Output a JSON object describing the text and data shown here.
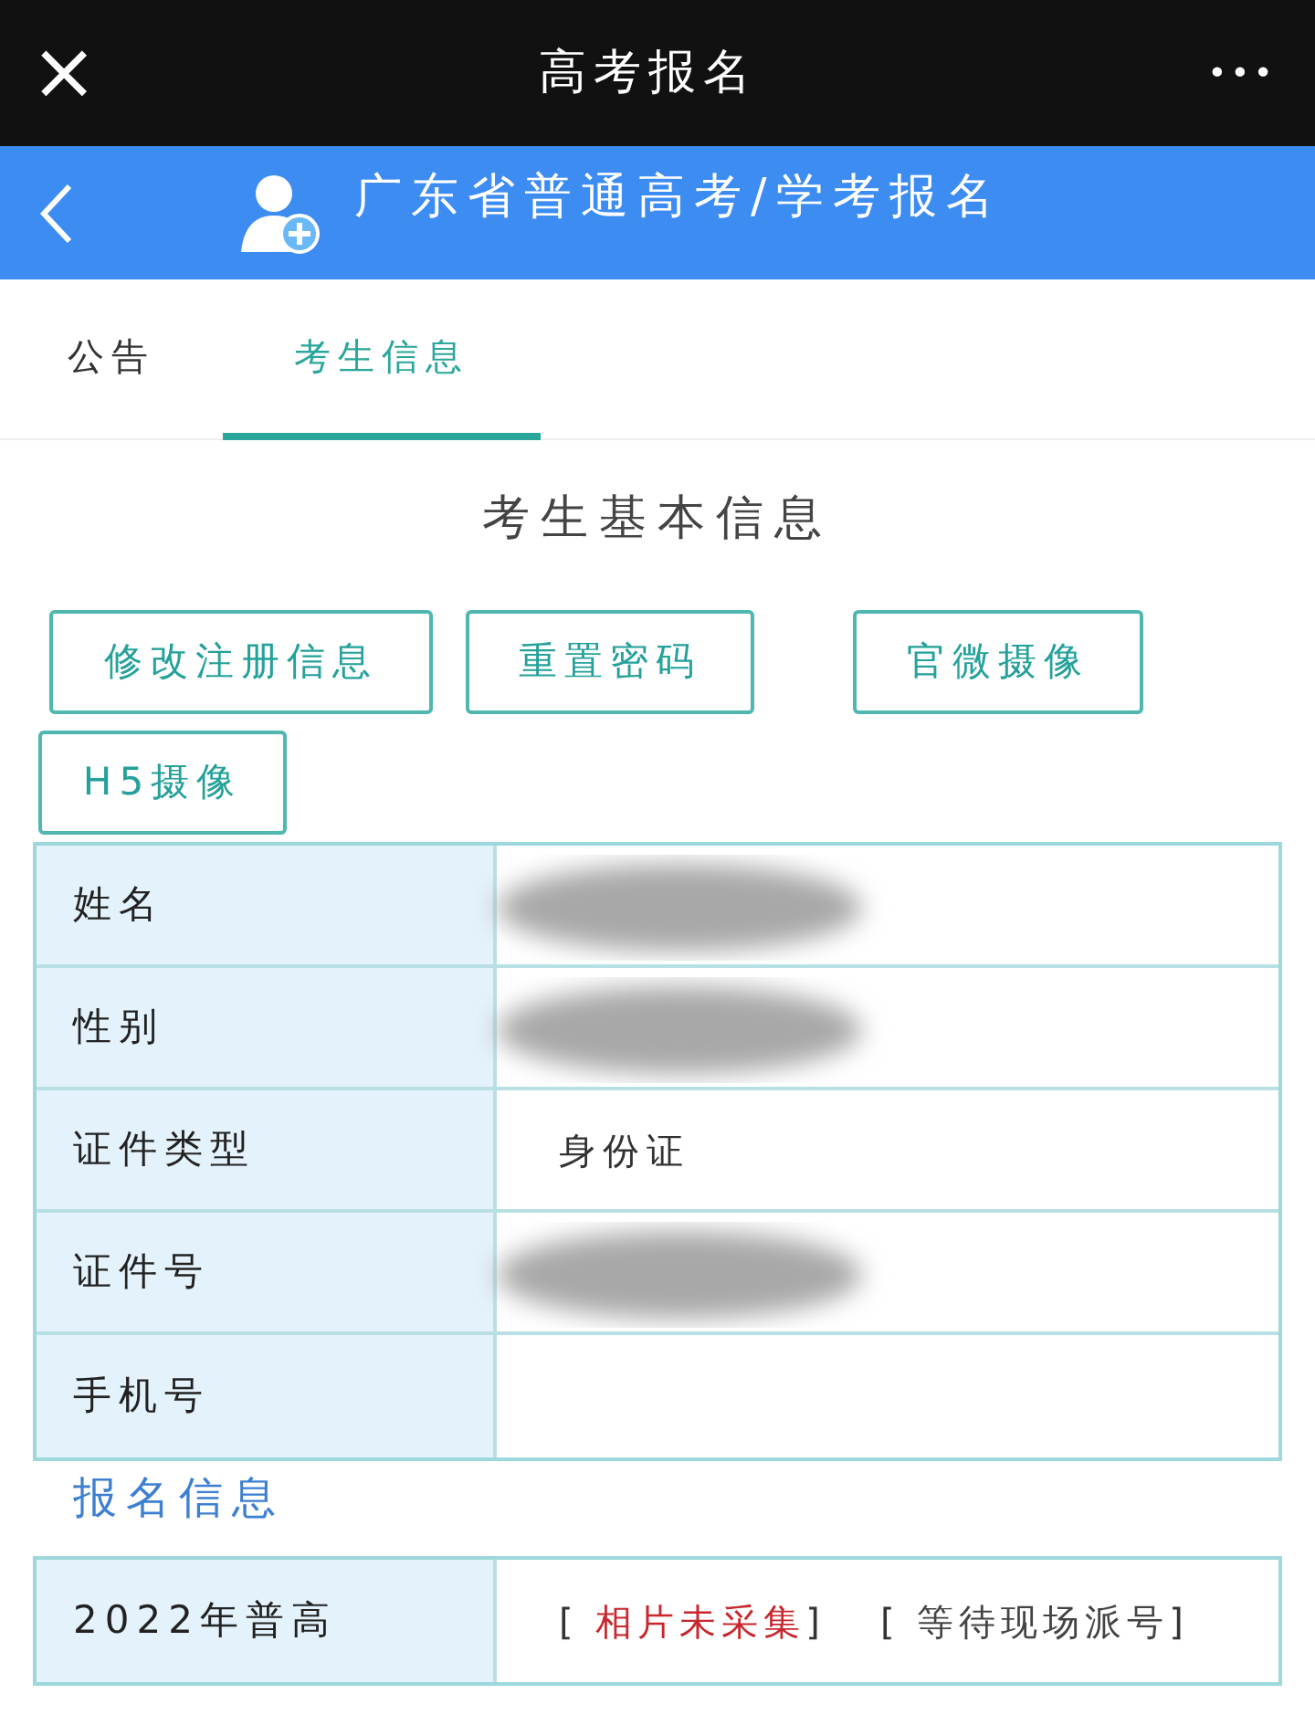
{
  "window": {
    "title": "高考报名",
    "close": "×",
    "more": "•••"
  },
  "header": {
    "title": "广东省普通高考/学考报名"
  },
  "tabs": [
    {
      "label": "公告",
      "selected": false
    },
    {
      "label": "考生信息",
      "selected": true
    }
  ],
  "section_title": "考生基本信息",
  "buttons": [
    "修改注册信息",
    "重置密码",
    "官微摄像",
    "H5摄像"
  ],
  "info_rows": [
    {
      "label": "姓名",
      "redacted": true
    },
    {
      "label": "性别",
      "redacted": true
    },
    {
      "label": "证件类型",
      "value": "身份证",
      "redacted": false
    },
    {
      "label": "证件号",
      "redacted": true
    },
    {
      "label": "手机号",
      "redacted": false
    }
  ],
  "registration": {
    "heading": "报名信息",
    "rows": [
      {
        "label": "2022年普高",
        "statuses": [
          {
            "open": "[",
            "text": "相片未采集",
            "close": "]",
            "color": "#c8272e"
          },
          {
            "open": "[",
            "text": "等待现场派号",
            "close": "]",
            "color": "#444444"
          }
        ]
      }
    ]
  }
}
